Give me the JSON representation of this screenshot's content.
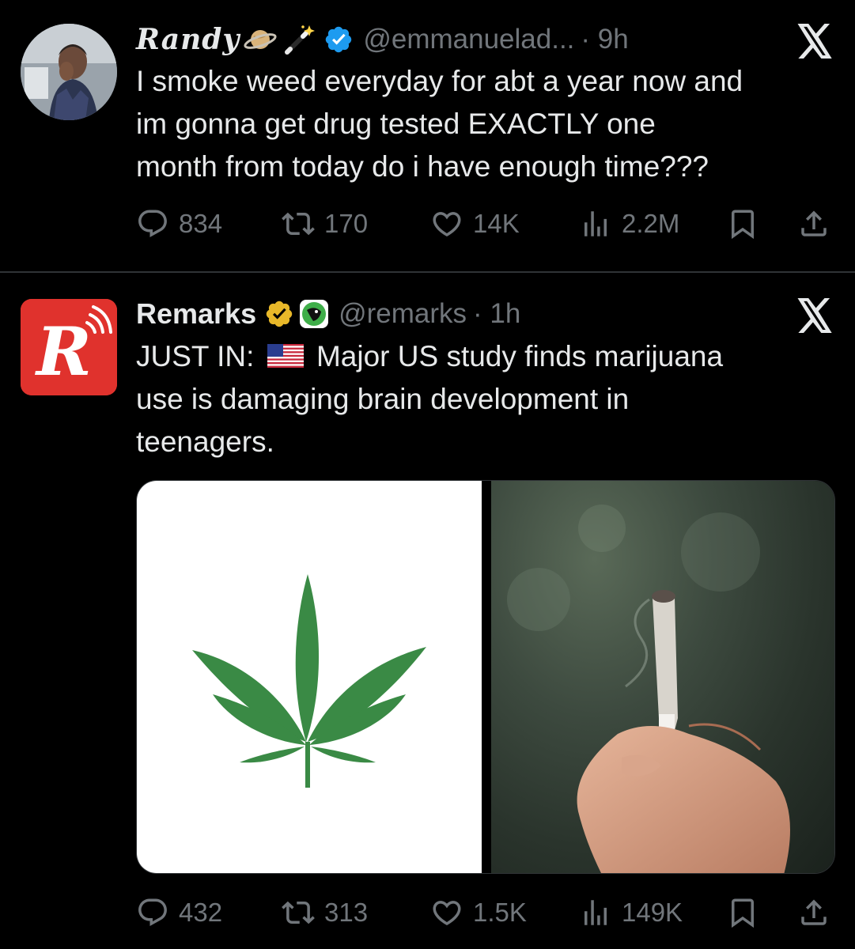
{
  "tweets": [
    {
      "name": "Randy",
      "handle": "@emmanuelad...",
      "time": "· 9h",
      "text_lines": [
        "I smoke weed everyday for abt a year now and",
        "im gonna get drug tested EXACTLY one",
        "month from today do i have enough time???"
      ],
      "replies": "834",
      "reposts": "170",
      "likes": "14K",
      "views": "2.2M",
      "verified_color": "#1d9bf0"
    },
    {
      "name": "Remarks",
      "handle": "@remarks",
      "time": "· 1h",
      "text_prefix": "JUST IN:",
      "text_after_flag": "Major US study finds marijuana",
      "text_lines": [
        "use is damaging brain development in",
        "teenagers."
      ],
      "replies": "432",
      "reposts": "313",
      "likes": "1.5K",
      "views": "149K",
      "verified_color": "#e8b829",
      "avatar_letter": "R",
      "avatar_color": "#e0322d"
    }
  ],
  "colors": {
    "text": "#e7e9ea",
    "secondary": "#71767b",
    "leaf": "#3a8a45"
  },
  "icons": [
    "reply-icon",
    "repost-icon",
    "like-icon",
    "views-icon",
    "bookmark-icon",
    "share-icon",
    "x-logo-icon"
  ]
}
